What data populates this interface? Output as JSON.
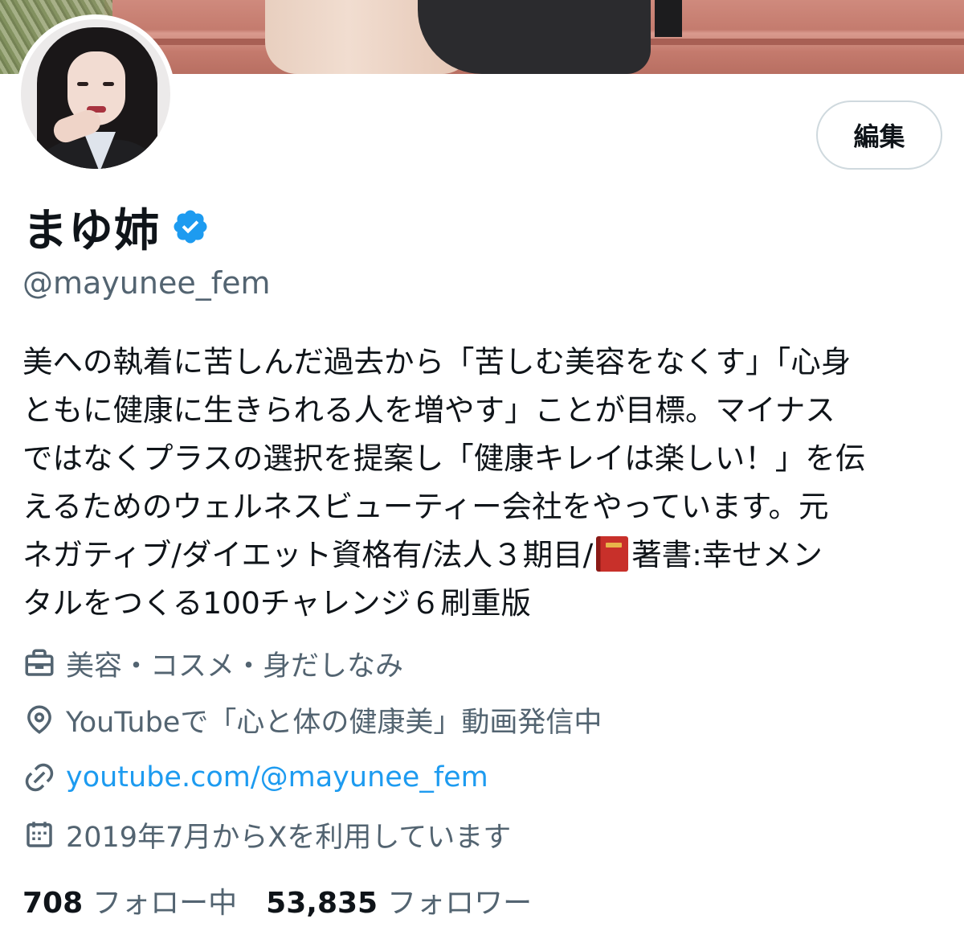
{
  "profile": {
    "display_name": "まゆ姉",
    "handle": "@mayunee_fem",
    "verified": true,
    "edit_label": "編集"
  },
  "bio_lines": [
    "美への執着に苦しんだ過去から「苦しむ美容をなくす」「心身",
    "ともに健康に生きられる人を増やす」ことが目標。マイナス",
    "ではなくプラスの選択を提案し「健康キレイは楽しい！」を伝",
    "えるためのウェルネスビューティー会社をやっています。元",
    "ネガティブ/ダイエット資格有/法人３期目/",
    "著書:幸せメン",
    "タルをつくる100チャレンジ６刷重版"
  ],
  "meta": {
    "category": "美容・コスメ・身だしなみ",
    "location": "YouTubeで「心と体の健康美」動画発信中",
    "url": "youtube.com/@mayunee_fem",
    "joined": "2019年7月からXを利用しています"
  },
  "stats": {
    "following_count": "708",
    "following_label": "フォロー中",
    "followers_count": "53,835",
    "followers_label": "フォロワー"
  },
  "icons": {
    "verified": "verified-badge-icon",
    "category": "briefcase-icon",
    "location": "location-pin-icon",
    "url": "link-icon",
    "joined": "calendar-icon",
    "book": "red-book-emoji"
  },
  "colors": {
    "text_primary": "#0f1419",
    "text_secondary": "#536471",
    "link": "#1d9bf0",
    "verified": "#1d9bf0",
    "button_border": "#cfd9de"
  }
}
